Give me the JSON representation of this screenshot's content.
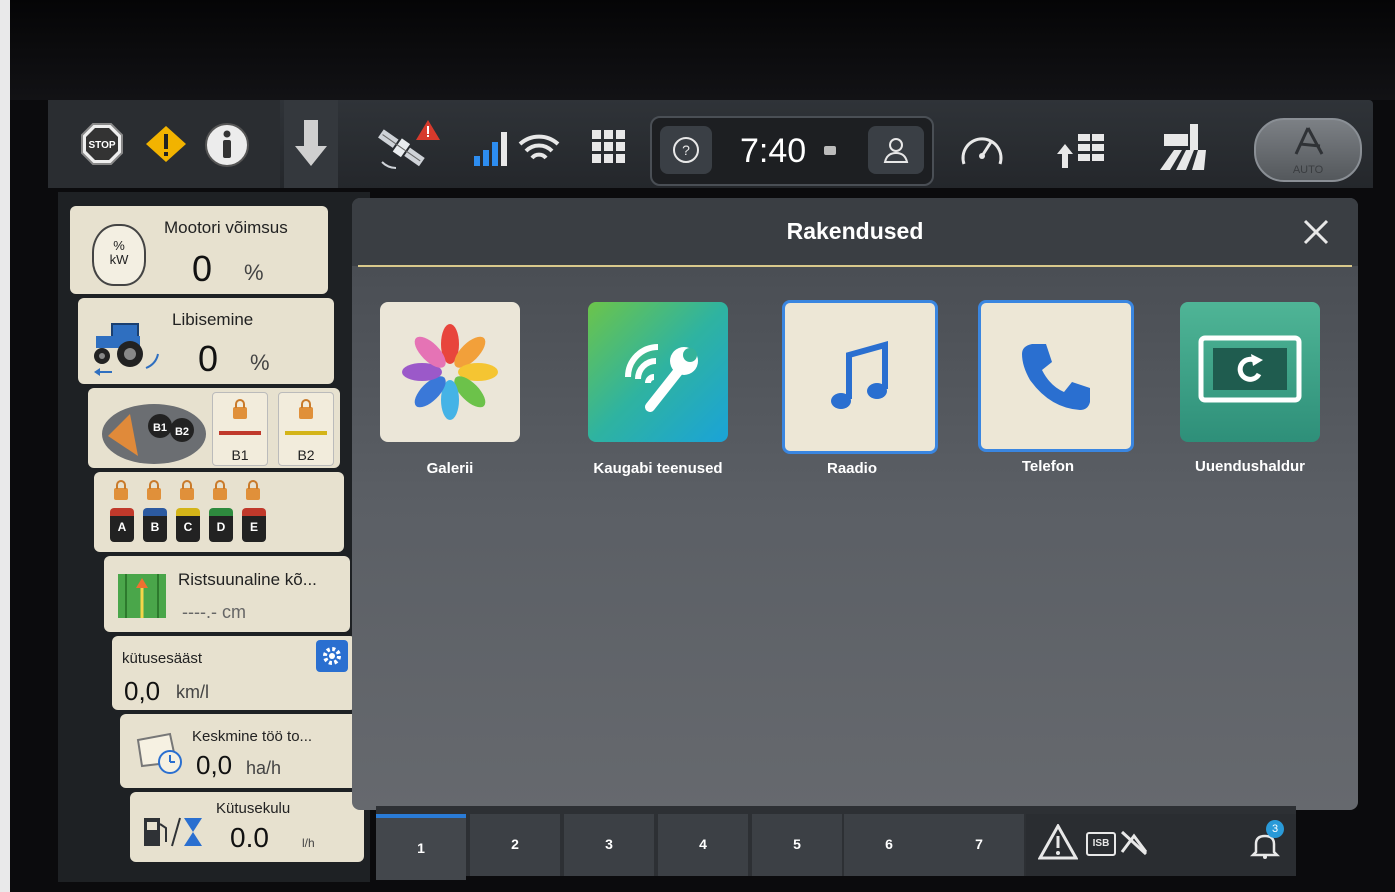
{
  "topbar": {
    "clock": "7:40",
    "help_label": "?",
    "auto_label": "AUTO",
    "stop_label": "STOP"
  },
  "widgets": {
    "engine": {
      "title": "Mootori võimsus",
      "value": "0",
      "unit": "%",
      "icon_top": "%",
      "icon_bottom": "kW"
    },
    "slip": {
      "title": "Libisemine",
      "value": "0",
      "unit": "%"
    },
    "remotes_b": {
      "labels": [
        "B1",
        "B2"
      ],
      "joystick_labels": [
        "B1",
        "B2"
      ]
    },
    "remotes_ae": {
      "labels": [
        "A",
        "B",
        "C",
        "D",
        "E"
      ],
      "colors": [
        "#c0392b",
        "#2c5aa0",
        "#d4b418",
        "#2e8a3e",
        "#c0392b"
      ]
    },
    "cross_track": {
      "title": "Ristsuunaline kõ...",
      "value": "----.- cm"
    },
    "fuel_saving": {
      "title": "kütusesääst",
      "value": "0,0",
      "unit": "km/l"
    },
    "avg_work": {
      "title": "Keskmine töö to...",
      "value": "0,0",
      "unit": "ha/h"
    },
    "fuel_use": {
      "title": "Kütusekulu",
      "value": "0.0",
      "unit": "l/h"
    }
  },
  "main": {
    "title": "Rakendused",
    "apps": [
      {
        "label": "Galerii",
        "icon": "gallery-icon"
      },
      {
        "label": "Kaugabi teenused",
        "icon": "remote-service-icon"
      },
      {
        "label": "Raadio",
        "icon": "music-note-icon"
      },
      {
        "label": "Telefon",
        "icon": "phone-icon"
      },
      {
        "label": "Uuendushaldur",
        "icon": "update-manager-icon"
      }
    ]
  },
  "tabs": [
    "1",
    "2",
    "3",
    "4",
    "5",
    "6",
    "7"
  ],
  "status": {
    "isb_label": "ISB",
    "notification_count": "3"
  }
}
